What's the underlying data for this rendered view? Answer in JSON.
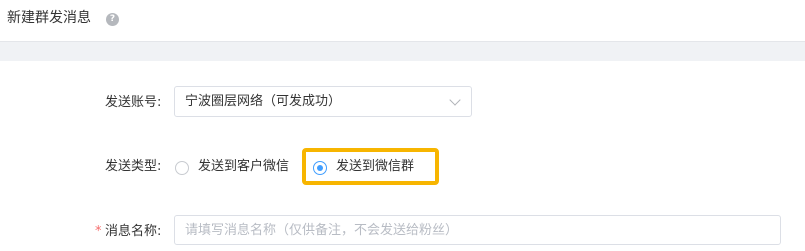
{
  "header": {
    "title": "新建群发消息",
    "help_icon": "question-circle-icon"
  },
  "form": {
    "account": {
      "label": "发送账号:",
      "value": "宁波圈层网络（可发成功）"
    },
    "send_type": {
      "label": "发送类型:",
      "options": [
        {
          "label": "发送到客户微信",
          "selected": false
        },
        {
          "label": "发送到微信群",
          "selected": true
        }
      ]
    },
    "message_name": {
      "required_mark": "*",
      "label": "消息名称:",
      "placeholder": "请填写消息名称（仅供备注，不会发送给粉丝）",
      "value": ""
    }
  },
  "colors": {
    "accent": "#409eff",
    "highlight": "#f7b500",
    "required": "#f56c6c",
    "band": "#f0f2f5"
  }
}
